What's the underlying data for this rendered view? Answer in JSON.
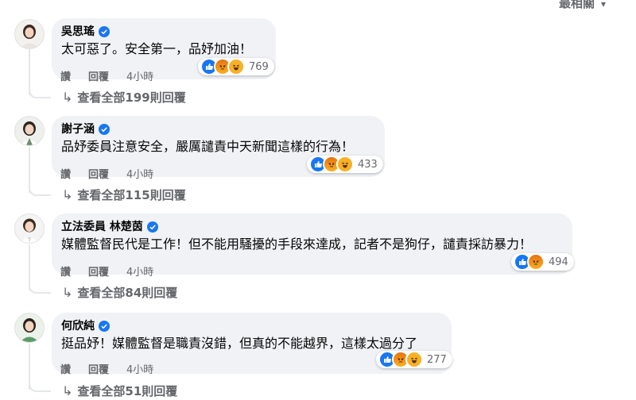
{
  "sort_label": "最相關",
  "comments": [
    {
      "name": "吳思瑤",
      "text": "太可惡了。安全第一，品妤加油！",
      "reaction_count": "769",
      "like_label": "讚",
      "reply_label": "回覆",
      "time": "4小時",
      "view_replies": "查看全部199則回覆"
    },
    {
      "name": "謝子涵",
      "text": "品妤委員注意安全，嚴厲譴責中天新聞這樣的行為！",
      "reaction_count": "433",
      "like_label": "讚",
      "reply_label": "回覆",
      "time": "4小時",
      "view_replies": "查看全部115則回覆"
    },
    {
      "name": "立法委員 林楚茵",
      "text": "媒體監督民代是工作！但不能用騷擾的手段來達成，記者不是狗仔，譴責採訪暴力！",
      "reaction_count": "494",
      "like_label": "讚",
      "reply_label": "回覆",
      "time": "4小時",
      "view_replies": "查看全部84則回覆"
    },
    {
      "name": "何欣純",
      "text": "挺品妤！媒體監督是職責沒錯，但真的不能越界，這樣太過分了",
      "reaction_count": "277",
      "like_label": "讚",
      "reply_label": "回覆",
      "time": "4小時",
      "view_replies": "查看全部51則回覆"
    }
  ],
  "colors": {
    "verified": "#1877f2",
    "bubble": "#f0f2f5",
    "secondary_text": "#65676b"
  }
}
